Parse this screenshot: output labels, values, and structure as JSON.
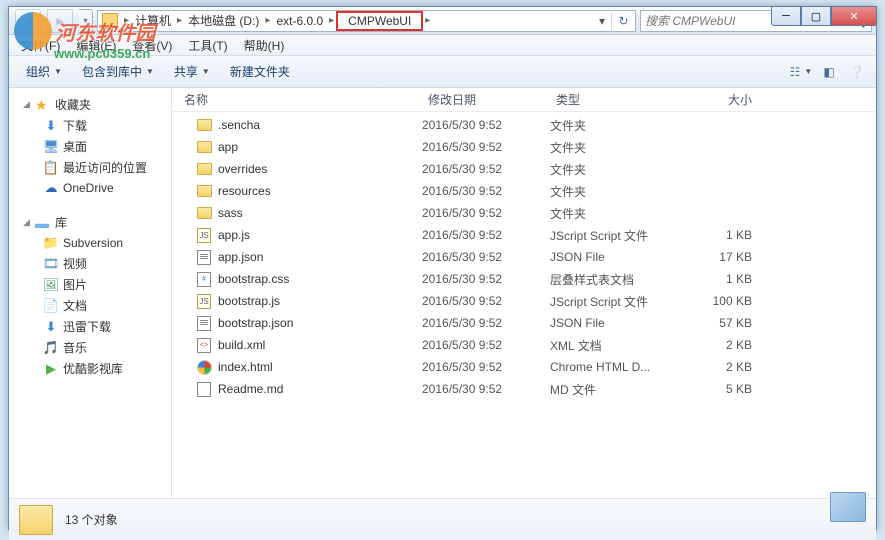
{
  "watermark": {
    "brand": "河东软件园",
    "url": "www.pc0359.cn"
  },
  "breadcrumbs": [
    "计算机",
    "本地磁盘 (D:)",
    "ext-6.0.0",
    "CMPWebUI"
  ],
  "search": {
    "placeholder": "搜索 CMPWebUI"
  },
  "menubar": [
    "文件(F)",
    "编辑(E)",
    "查看(V)",
    "工具(T)",
    "帮助(H)"
  ],
  "toolbar": {
    "organize": "组织",
    "include": "包含到库中",
    "share": "共享",
    "newfolder": "新建文件夹"
  },
  "sidebar": {
    "favorites": {
      "label": "收藏夹",
      "items": [
        {
          "icon": "⬇",
          "color": "#3a80e8",
          "label": "下载"
        },
        {
          "icon": "🖥",
          "color": "#4a90d0",
          "label": "桌面"
        },
        {
          "icon": "📋",
          "color": "#8a6a50",
          "label": "最近访问的位置"
        },
        {
          "icon": "☁",
          "color": "#2a6ab0",
          "label": "OneDrive"
        }
      ]
    },
    "libraries": {
      "label": "库",
      "items": [
        {
          "icon": "📁",
          "color": "#d4a843",
          "label": "Subversion"
        },
        {
          "icon": "🎞",
          "color": "#5a90c0",
          "label": "视频"
        },
        {
          "icon": "🖼",
          "color": "#50a070",
          "label": "图片"
        },
        {
          "icon": "📄",
          "color": "#c09050",
          "label": "文档"
        },
        {
          "icon": "⬇",
          "color": "#3a80e8",
          "label": "迅雷下载"
        },
        {
          "icon": "🎵",
          "color": "#4a90d0",
          "label": "音乐"
        },
        {
          "icon": "▶",
          "color": "#50b050",
          "label": "优酷影视库"
        }
      ]
    }
  },
  "columns": {
    "name": "名称",
    "date": "修改日期",
    "type": "类型",
    "size": "大小"
  },
  "files": [
    {
      "icon": "folder",
      "name": ".sencha",
      "date": "2016/5/30 9:52",
      "type": "文件夹",
      "size": ""
    },
    {
      "icon": "folder",
      "name": "app",
      "date": "2016/5/30 9:52",
      "type": "文件夹",
      "size": ""
    },
    {
      "icon": "folder",
      "name": "overrides",
      "date": "2016/5/30 9:52",
      "type": "文件夹",
      "size": ""
    },
    {
      "icon": "folder",
      "name": "resources",
      "date": "2016/5/30 9:52",
      "type": "文件夹",
      "size": ""
    },
    {
      "icon": "folder",
      "name": "sass",
      "date": "2016/5/30 9:52",
      "type": "文件夹",
      "size": ""
    },
    {
      "icon": "js",
      "name": "app.js",
      "date": "2016/5/30 9:52",
      "type": "JScript Script 文件",
      "size": "1 KB"
    },
    {
      "icon": "json",
      "name": "app.json",
      "date": "2016/5/30 9:52",
      "type": "JSON File",
      "size": "17 KB"
    },
    {
      "icon": "css",
      "name": "bootstrap.css",
      "date": "2016/5/30 9:52",
      "type": "层叠样式表文档",
      "size": "1 KB"
    },
    {
      "icon": "js",
      "name": "bootstrap.js",
      "date": "2016/5/30 9:52",
      "type": "JScript Script 文件",
      "size": "100 KB"
    },
    {
      "icon": "json",
      "name": "bootstrap.json",
      "date": "2016/5/30 9:52",
      "type": "JSON File",
      "size": "57 KB"
    },
    {
      "icon": "xml",
      "name": "build.xml",
      "date": "2016/5/30 9:52",
      "type": "XML 文档",
      "size": "2 KB"
    },
    {
      "icon": "html",
      "name": "index.html",
      "date": "2016/5/30 9:52",
      "type": "Chrome HTML D...",
      "size": "2 KB"
    },
    {
      "icon": "md",
      "name": "Readme.md",
      "date": "2016/5/30 9:52",
      "type": "MD 文件",
      "size": "5 KB"
    }
  ],
  "statusbar": {
    "count": "13 个对象"
  }
}
